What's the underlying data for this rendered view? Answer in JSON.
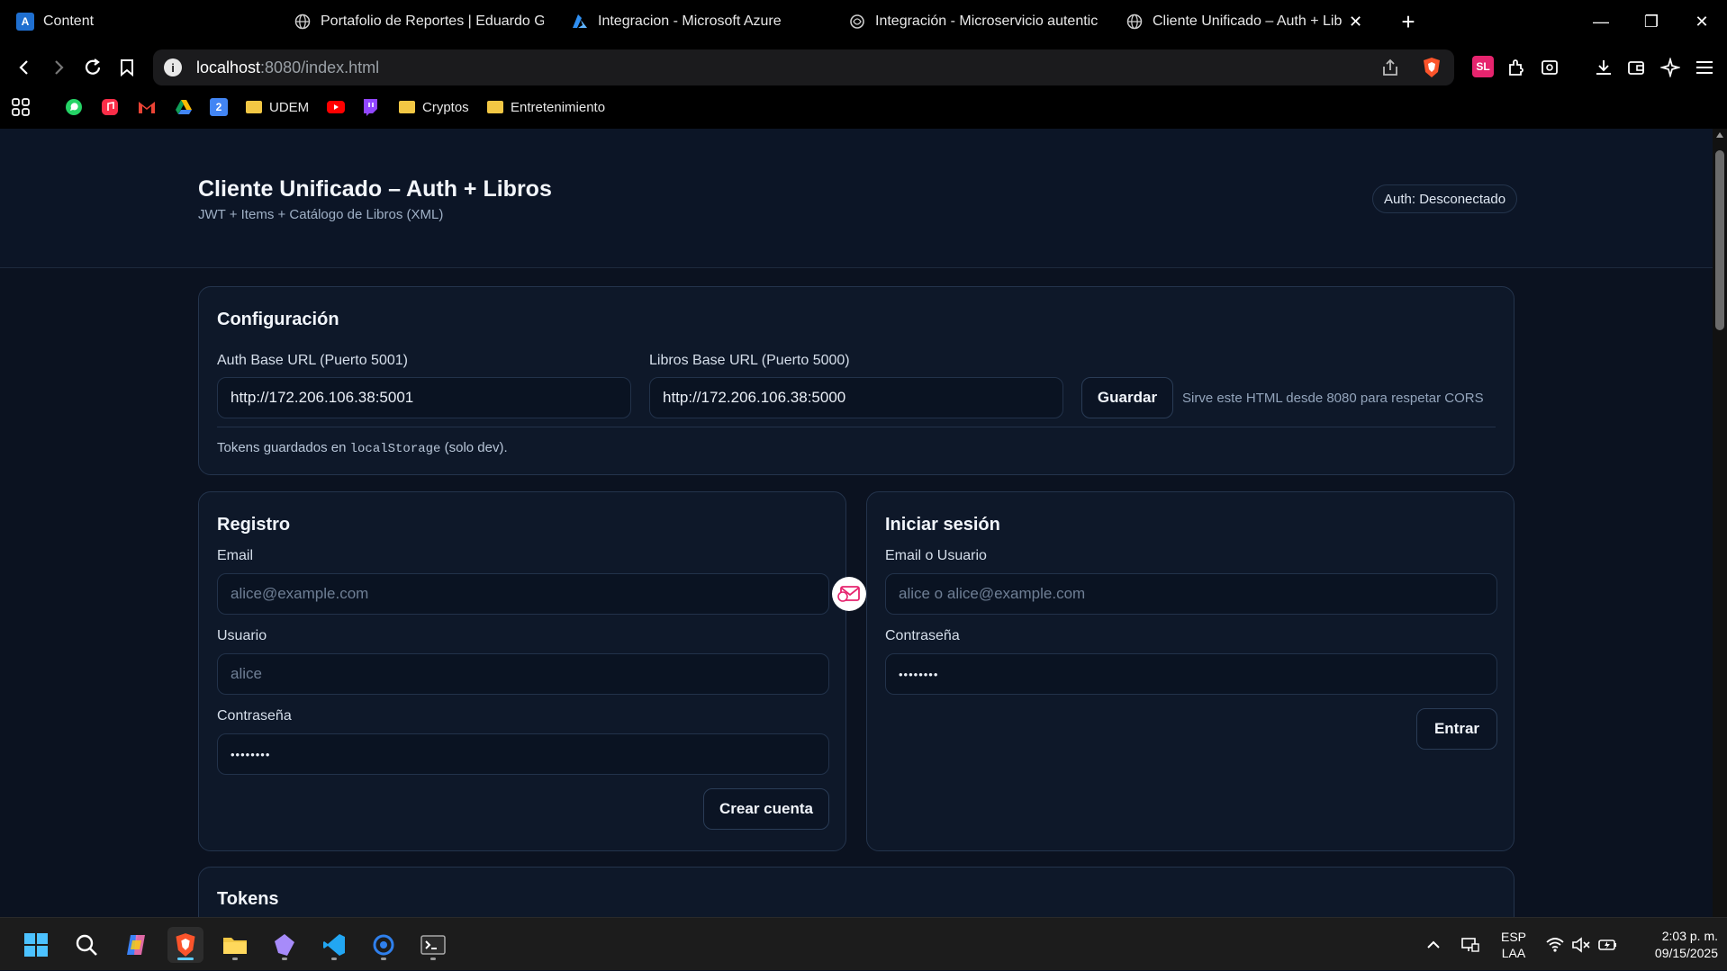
{
  "browser": {
    "tabs": [
      {
        "title": "Content",
        "icon": "azure-a-icon"
      },
      {
        "title": "Portafolio de Reportes | Eduardo Gar…",
        "icon": "globe-icon"
      },
      {
        "title": "Integracion - Microsoft Azure",
        "icon": "azure-icon"
      },
      {
        "title": "Integración - Microservicio autentica…",
        "icon": "chatgpt-icon"
      },
      {
        "title": "Cliente Unificado – Auth + Libros",
        "icon": "globe-icon"
      }
    ],
    "url_host": "localhost",
    "url_rest": ":8080/index.html",
    "bookmarks": [
      "UDEM",
      "Cryptos",
      "Entretenimiento"
    ],
    "extension_label": "SL"
  },
  "app": {
    "title": "Cliente Unificado – Auth + Libros",
    "subtitle": "JWT + Items + Catálogo de Libros (XML)",
    "auth_status": "Auth: Desconectado"
  },
  "config": {
    "heading": "Configuración",
    "auth_label": "Auth Base URL (Puerto 5001)",
    "auth_value": "http://172.206.106.38:5001",
    "libros_label": "Libros Base URL (Puerto 5000)",
    "libros_value": "http://172.206.106.38:5000",
    "save_label": "Guardar",
    "cors_note": "Sirve este HTML desde 8080 para respetar CORS",
    "tokens_note_pre": "Tokens guardados en ",
    "tokens_note_code": "localStorage",
    "tokens_note_post": " (solo dev)."
  },
  "registro": {
    "heading": "Registro",
    "email_label": "Email",
    "email_placeholder": "alice@example.com",
    "user_label": "Usuario",
    "user_placeholder": "alice",
    "pass_label": "Contraseña",
    "pass_value": "••••••••",
    "submit_label": "Crear cuenta"
  },
  "login": {
    "heading": "Iniciar sesión",
    "user_label": "Email o Usuario",
    "user_placeholder": "alice o alice@example.com",
    "pass_label": "Contraseña",
    "pass_value": "••••••••",
    "submit_label": "Entrar"
  },
  "tokens": {
    "heading": "Tokens"
  },
  "taskbar": {
    "lang_top": "ESP",
    "lang_bottom": "LAA",
    "time": "2:03 p. m.",
    "date": "09/15/2025"
  }
}
